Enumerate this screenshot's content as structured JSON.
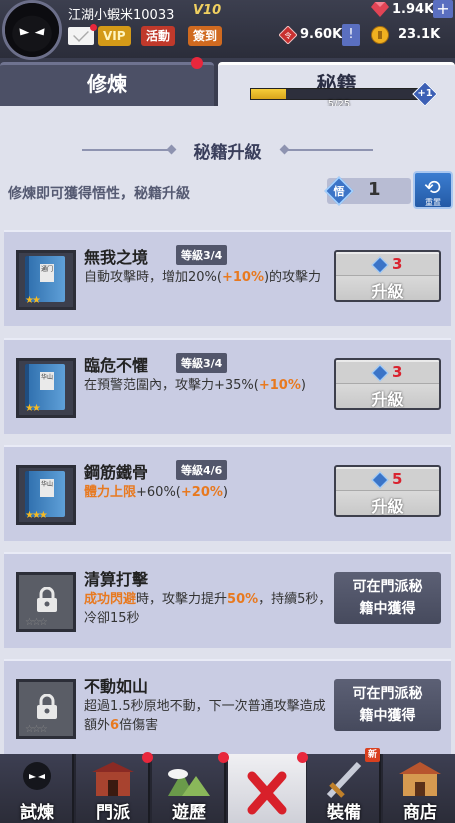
{
  "header": {
    "username": "江湖小蝦米10033",
    "vip_level": "V10",
    "vip_label": "VIP",
    "event_label": "活動",
    "signin_label": "簽到",
    "gems": "1.94K",
    "red_coins": "9.60K",
    "gold": "23.1K",
    "plus": "+",
    "warn": "!"
  },
  "tabs": {
    "cultivate": "修煉",
    "secret": "秘籍",
    "progress_text": "5/25",
    "progress_fraction": 0.2,
    "plus_badge": "+1"
  },
  "main": {
    "section_title": "秘籍升級",
    "subtitle": "修煉即可獲得悟性，秘籍升級",
    "insight_icon": "悟",
    "insight_value": "1",
    "reset_label": "重置"
  },
  "cards": [
    {
      "name": "無我之境",
      "level": "等級3/4",
      "book_label": "通门",
      "desc_pre": "自動攻擊時，增加20%(",
      "desc_orange": "+10%",
      "desc_post": ")的攻擊力",
      "cost": "3",
      "button": "升級",
      "stars": "★★"
    },
    {
      "name": "臨危不懼",
      "level": "等級3/4",
      "book_label": "华山",
      "desc_pre": "在預警范圍內，攻擊力+35%(",
      "desc_orange": "+10%",
      "desc_post": ")",
      "cost": "3",
      "button": "升級",
      "stars": "★★"
    },
    {
      "name": "鋼筋鐵骨",
      "level": "等級4/6",
      "book_label": "华山",
      "desc_orange_pre": "體力上限",
      "desc_pre": "+60%(",
      "desc_orange": "+20%",
      "desc_post": ")",
      "cost": "5",
      "button": "升級",
      "stars": "★★★"
    },
    {
      "name": "清算打擊",
      "desc_orange_pre": "成功閃避",
      "desc_pre": "時，攻擊力提升",
      "desc_orange": "50%",
      "desc_post": "，持續5秒，冷卻15秒",
      "button_line1": "可在門派秘",
      "button_line2": "籍中獲得",
      "stars": "☆☆☆"
    },
    {
      "name": "不動如山",
      "desc_pre": "超過1.5秒原地不動，下一次普通攻擊造成額外",
      "desc_orange": "6",
      "desc_post": "倍傷害",
      "button_line1": "可在門派秘",
      "button_line2": "籍中獲得",
      "stars": "☆☆☆"
    }
  ],
  "bottom_nav": {
    "trial": "試煉",
    "sect": "門派",
    "travel": "遊歷",
    "equip": "裝備",
    "shop": "商店",
    "new_badge": "新"
  }
}
